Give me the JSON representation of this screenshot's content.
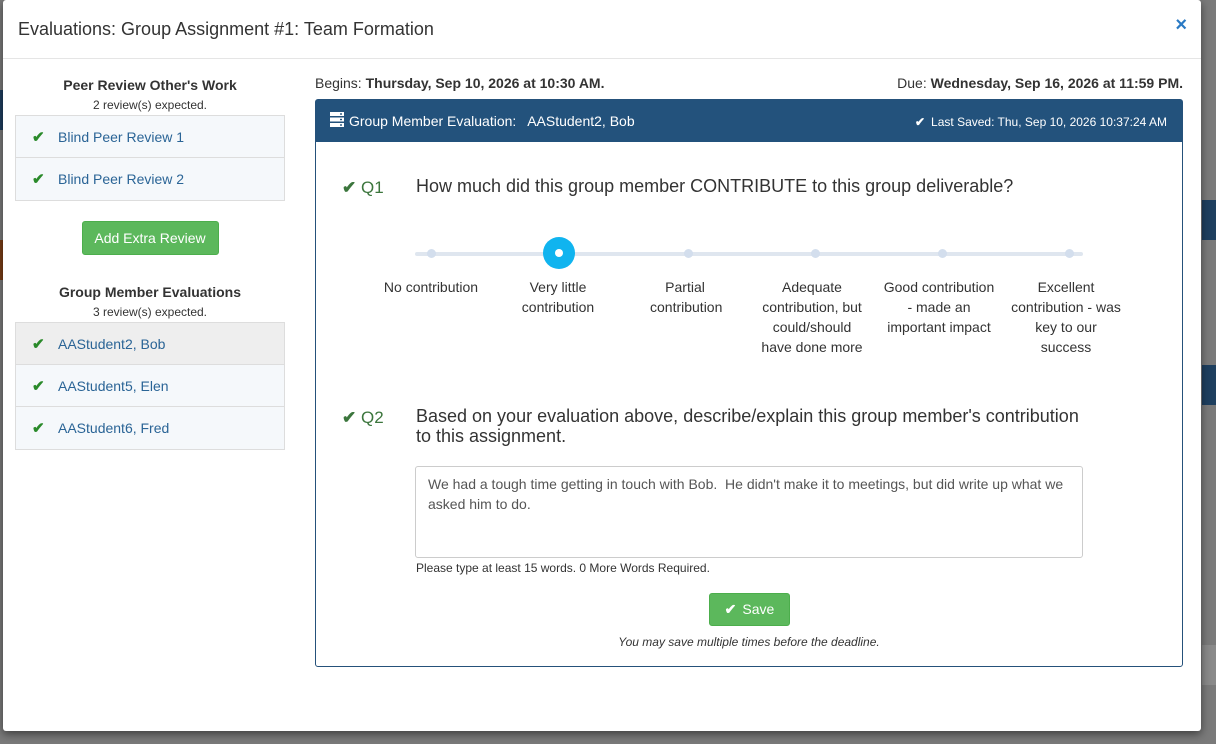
{
  "modal": {
    "title": "Evaluations: Group Assignment #1: Team Formation",
    "close": "×"
  },
  "left": {
    "peer_review": {
      "title": "Peer Review Other's Work",
      "expected": "2 review(s) expected.",
      "items": [
        {
          "label": "Blind Peer Review 1",
          "check": "✔"
        },
        {
          "label": "Blind Peer Review 2",
          "check": "✔"
        }
      ],
      "add_button": "Add Extra Review"
    },
    "group_eval": {
      "title": "Group Member Evaluations",
      "expected": "3 review(s) expected.",
      "items": [
        {
          "label": "AAStudent2, Bob",
          "check": "✔"
        },
        {
          "label": "AAStudent5, Elen",
          "check": "✔"
        },
        {
          "label": "AAStudent6, Fred",
          "check": "✔"
        }
      ]
    }
  },
  "dates": {
    "begins_label": "Begins:",
    "begins_value": "Thursday, Sep 10, 2026 at 10:30 AM.",
    "due_label": "Due:",
    "due_value": "Wednesday, Sep 16, 2026 at 11:59 PM."
  },
  "panel": {
    "title": "Group Member Evaluation:   AAStudent2, Bob",
    "last_saved": "Last Saved: Thu, Sep 10, 2026 10:37:24 AM"
  },
  "q1": {
    "number": "Q1",
    "text": "How much did this group member CONTRIBUTE to this group deliverable?",
    "options": [
      "No contribution",
      "Very little contribution",
      "Partial contribution",
      "Adequate contribution, but could/should have done more",
      "Good contribution - made an important impact",
      "Excellent contribution - was key to our success"
    ],
    "selected_index": 1
  },
  "q2": {
    "number": "Q2",
    "text": "Based on your evaluation above, describe/explain this group member's contribution to this assignment.",
    "answer": "We had a tough time getting in touch with Bob.  He didn't make it to meetings, but did write up what we asked him to do.",
    "hint": "Please type at least 15 words. 0 More Words Required."
  },
  "save": {
    "label": "Save",
    "note": "You may save multiple times before the deadline."
  },
  "colors": {
    "header_blue": "#23527c",
    "green": "#5cb85c",
    "knob": "#10b4ef"
  }
}
